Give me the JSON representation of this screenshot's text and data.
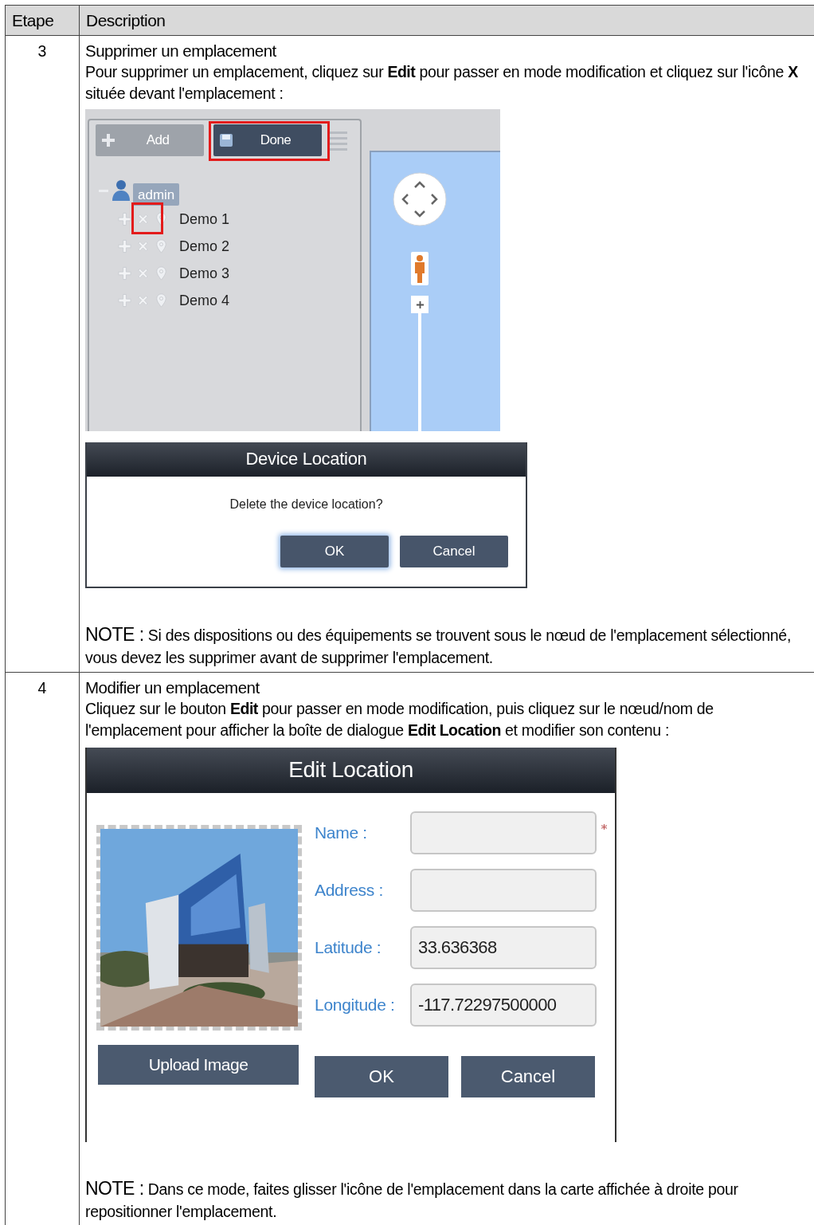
{
  "table": {
    "columns": [
      "Etape",
      "Description"
    ],
    "rows": [
      {
        "step": "3",
        "title": "Supprimer un emplacement",
        "text": "Pour supprimer un emplacement, cliquez sur **Edit** pour passer en mode modification et cliquez sur l'icône **X** située devant l'emplacement :",
        "figures": [
          {
            "kind": "tree_panel",
            "buttons": [
              {
                "label": "Add",
                "disabled": true,
                "highlighted": false
              },
              {
                "label": "Done",
                "disabled": false,
                "highlighted": true
              }
            ],
            "tree": {
              "label": "admin",
              "expanded": true,
              "children": [
                {
                  "label": "Demo 1",
                  "highlighted": true
                },
                {
                  "label": "Demo 2",
                  "highlighted": false
                },
                {
                  "label": "Demo 3",
                  "highlighted": false
                },
                {
                  "label": "Demo 4",
                  "highlighted": false
                }
              ]
            },
            "zoom_slider": {
              "level": 1
            }
          },
          {
            "kind": "confirm_dialog",
            "title": "Device Location",
            "message": "Delete the device location?",
            "buttons": [
              {
                "label": "OK",
                "focused": true
              },
              {
                "label": "Cancel",
                "focused": false
              }
            ]
          }
        ],
        "note_label": "NOTE :",
        "note": "Si des dispositions ou des équipements se trouvent sous le nœud de l'emplacement sélectionné, vous devez les supprimer avant de supprimer l'emplacement."
      },
      {
        "step": "4",
        "title": "Modifier un emplacement",
        "text": "Cliquez sur le bouton **Edit** pour passer en mode modification, puis cliquez sur le nœud/nom de l'emplacement pour afficher la boîte de dialogue **Edit Location** et modifier son contenu :",
        "figures": [
          {
            "kind": "edit_dialog",
            "title": "Edit Location",
            "upload_button": "Upload Image",
            "fields": [
              {
                "label": "Name :",
                "required": true
              },
              {
                "label": "Address :",
                "required": false
              },
              {
                "label": "Latitude :",
                "value": "33.636368",
                "required": false
              },
              {
                "label": "Longitude :",
                "value": "-117.72297500000",
                "required": false
              }
            ],
            "buttons": [
              {
                "label": "OK",
                "focused": false
              },
              {
                "label": "Cancel",
                "focused": false
              }
            ]
          }
        ],
        "note_label": "NOTE :",
        "note": "Dans ce mode, faites glisser l'icône de l'emplacement dans la carte affichée à droite pour repositionner l'emplacement."
      }
    ]
  }
}
